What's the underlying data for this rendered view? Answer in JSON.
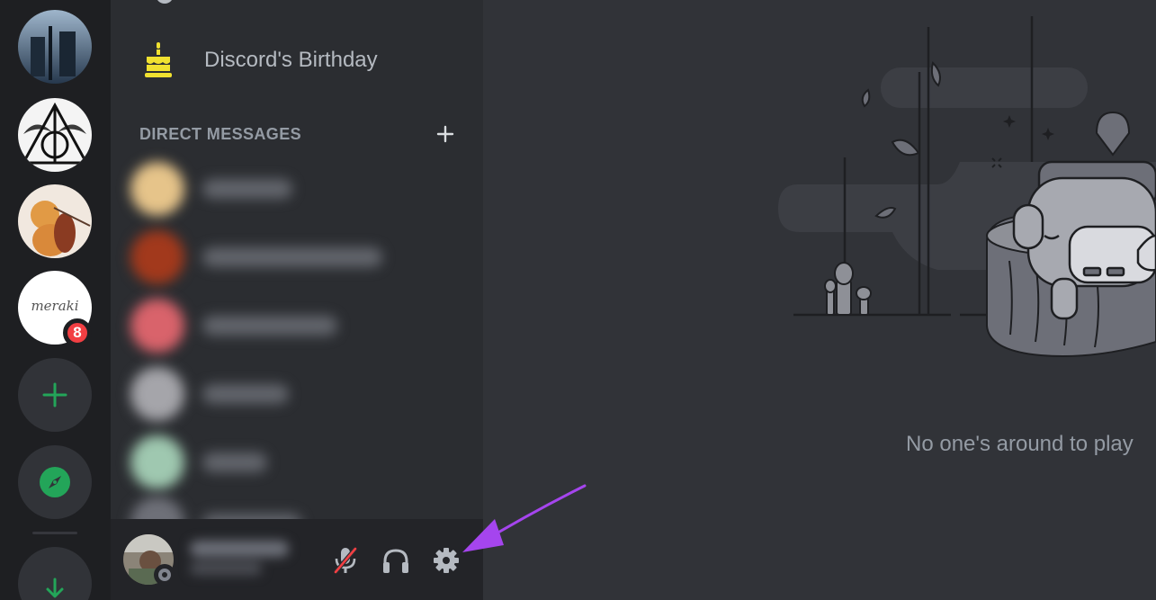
{
  "servers": [
    {
      "name": "server-tenet",
      "colors": [
        "#2e4a66",
        "#8aa7c2"
      ]
    },
    {
      "name": "server-deathly-hallows",
      "colors": [
        "#ffffff",
        "#2a2a2a"
      ]
    },
    {
      "name": "server-cat-cello",
      "colors": [
        "#f2e7dd",
        "#d88a3a"
      ]
    },
    {
      "name": "server-meraki",
      "label": "meraki",
      "badge": "8"
    }
  ],
  "rail": {
    "add_icon": "plus-icon",
    "explore_icon": "compass-icon",
    "download_icon": "download-icon",
    "accent": "#23a559"
  },
  "birthday": {
    "label": "Discord's Birthday",
    "icon": "cake-icon",
    "icon_color": "#f0e130"
  },
  "direct_messages": {
    "header": "DIRECT MESSAGES",
    "add_icon": "plus-icon"
  },
  "user_panel": {
    "controls": [
      {
        "name": "mute-microphone-icon",
        "state": "muted"
      },
      {
        "name": "headphones-icon"
      },
      {
        "name": "settings-gear-icon"
      }
    ]
  },
  "main": {
    "empty_text": "No one's around to play"
  },
  "annotation": {
    "arrow_color": "#a545ee"
  }
}
